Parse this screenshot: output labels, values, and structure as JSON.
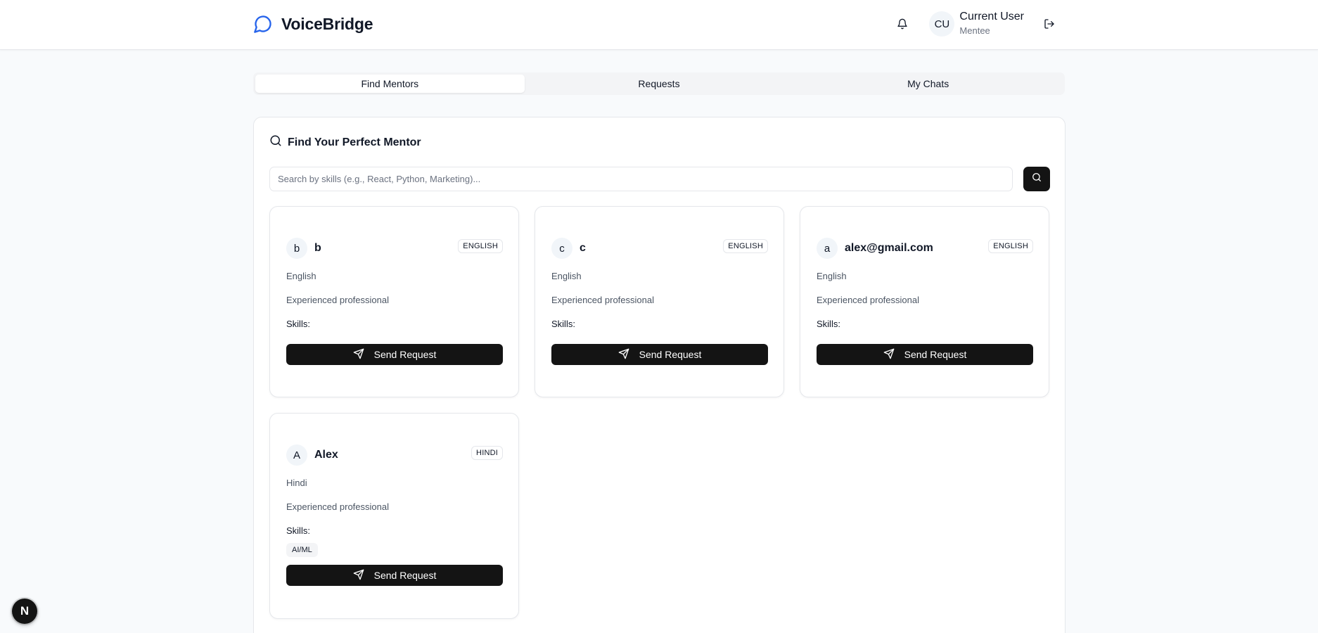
{
  "app": {
    "name": "VoiceBridge",
    "icon": "message-circle-icon",
    "accent": "#2563eb"
  },
  "header": {
    "notification_icon": "bell-icon",
    "user": {
      "initials": "CU",
      "name": "Current User",
      "role": "Mentee"
    },
    "logout_icon": "logout-icon"
  },
  "tabs": [
    {
      "label": "Find Mentors",
      "active": true
    },
    {
      "label": "Requests",
      "active": false
    },
    {
      "label": "My Chats",
      "active": false
    }
  ],
  "panel": {
    "title": "Find Your Perfect Mentor",
    "search": {
      "placeholder": "Search by skills (e.g., React, Python, Marketing)...",
      "value": ""
    }
  },
  "mentors": [
    {
      "initial": "b",
      "name": "b",
      "badge": "ENGLISH",
      "language": "English",
      "description": "Experienced professional",
      "skills_label": "Skills:",
      "skills": [],
      "button": "Send Request"
    },
    {
      "initial": "c",
      "name": "c",
      "badge": "ENGLISH",
      "language": "English",
      "description": "Experienced professional",
      "skills_label": "Skills:",
      "skills": [],
      "button": "Send Request"
    },
    {
      "initial": "a",
      "name": "alex@gmail.com",
      "badge": "ENGLISH",
      "language": "English",
      "description": "Experienced professional",
      "skills_label": "Skills:",
      "skills": [],
      "button": "Send Request"
    },
    {
      "initial": "A",
      "name": "Alex",
      "badge": "HINDI",
      "language": "Hindi",
      "description": "Experienced professional",
      "skills_label": "Skills:",
      "skills": [
        "AI/ML"
      ],
      "button": "Send Request"
    }
  ],
  "dev_badge": {
    "label": "N"
  }
}
